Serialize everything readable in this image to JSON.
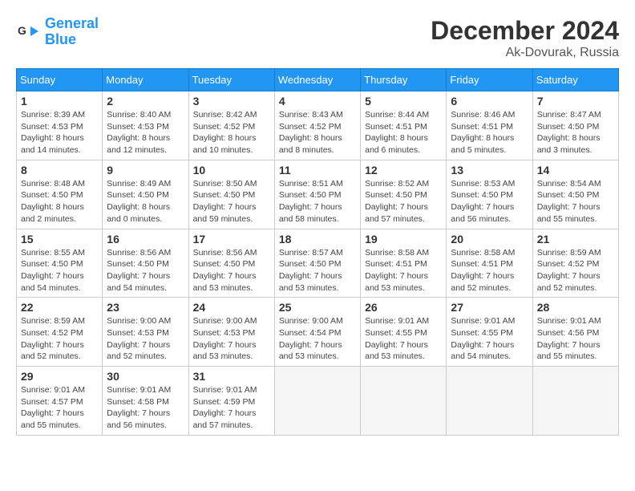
{
  "header": {
    "logo_line1": "General",
    "logo_line2": "Blue",
    "month_year": "December 2024",
    "location": "Ak-Dovurak, Russia"
  },
  "weekdays": [
    "Sunday",
    "Monday",
    "Tuesday",
    "Wednesday",
    "Thursday",
    "Friday",
    "Saturday"
  ],
  "weeks": [
    [
      {
        "day": "1",
        "info": "Sunrise: 8:39 AM\nSunset: 4:53 PM\nDaylight: 8 hours\nand 14 minutes."
      },
      {
        "day": "2",
        "info": "Sunrise: 8:40 AM\nSunset: 4:53 PM\nDaylight: 8 hours\nand 12 minutes."
      },
      {
        "day": "3",
        "info": "Sunrise: 8:42 AM\nSunset: 4:52 PM\nDaylight: 8 hours\nand 10 minutes."
      },
      {
        "day": "4",
        "info": "Sunrise: 8:43 AM\nSunset: 4:52 PM\nDaylight: 8 hours\nand 8 minutes."
      },
      {
        "day": "5",
        "info": "Sunrise: 8:44 AM\nSunset: 4:51 PM\nDaylight: 8 hours\nand 6 minutes."
      },
      {
        "day": "6",
        "info": "Sunrise: 8:46 AM\nSunset: 4:51 PM\nDaylight: 8 hours\nand 5 minutes."
      },
      {
        "day": "7",
        "info": "Sunrise: 8:47 AM\nSunset: 4:50 PM\nDaylight: 8 hours\nand 3 minutes."
      }
    ],
    [
      {
        "day": "8",
        "info": "Sunrise: 8:48 AM\nSunset: 4:50 PM\nDaylight: 8 hours\nand 2 minutes."
      },
      {
        "day": "9",
        "info": "Sunrise: 8:49 AM\nSunset: 4:50 PM\nDaylight: 8 hours\nand 0 minutes."
      },
      {
        "day": "10",
        "info": "Sunrise: 8:50 AM\nSunset: 4:50 PM\nDaylight: 7 hours\nand 59 minutes."
      },
      {
        "day": "11",
        "info": "Sunrise: 8:51 AM\nSunset: 4:50 PM\nDaylight: 7 hours\nand 58 minutes."
      },
      {
        "day": "12",
        "info": "Sunrise: 8:52 AM\nSunset: 4:50 PM\nDaylight: 7 hours\nand 57 minutes."
      },
      {
        "day": "13",
        "info": "Sunrise: 8:53 AM\nSunset: 4:50 PM\nDaylight: 7 hours\nand 56 minutes."
      },
      {
        "day": "14",
        "info": "Sunrise: 8:54 AM\nSunset: 4:50 PM\nDaylight: 7 hours\nand 55 minutes."
      }
    ],
    [
      {
        "day": "15",
        "info": "Sunrise: 8:55 AM\nSunset: 4:50 PM\nDaylight: 7 hours\nand 54 minutes."
      },
      {
        "day": "16",
        "info": "Sunrise: 8:56 AM\nSunset: 4:50 PM\nDaylight: 7 hours\nand 54 minutes."
      },
      {
        "day": "17",
        "info": "Sunrise: 8:56 AM\nSunset: 4:50 PM\nDaylight: 7 hours\nand 53 minutes."
      },
      {
        "day": "18",
        "info": "Sunrise: 8:57 AM\nSunset: 4:50 PM\nDaylight: 7 hours\nand 53 minutes."
      },
      {
        "day": "19",
        "info": "Sunrise: 8:58 AM\nSunset: 4:51 PM\nDaylight: 7 hours\nand 53 minutes."
      },
      {
        "day": "20",
        "info": "Sunrise: 8:58 AM\nSunset: 4:51 PM\nDaylight: 7 hours\nand 52 minutes."
      },
      {
        "day": "21",
        "info": "Sunrise: 8:59 AM\nSunset: 4:52 PM\nDaylight: 7 hours\nand 52 minutes."
      }
    ],
    [
      {
        "day": "22",
        "info": "Sunrise: 8:59 AM\nSunset: 4:52 PM\nDaylight: 7 hours\nand 52 minutes."
      },
      {
        "day": "23",
        "info": "Sunrise: 9:00 AM\nSunset: 4:53 PM\nDaylight: 7 hours\nand 52 minutes."
      },
      {
        "day": "24",
        "info": "Sunrise: 9:00 AM\nSunset: 4:53 PM\nDaylight: 7 hours\nand 53 minutes."
      },
      {
        "day": "25",
        "info": "Sunrise: 9:00 AM\nSunset: 4:54 PM\nDaylight: 7 hours\nand 53 minutes."
      },
      {
        "day": "26",
        "info": "Sunrise: 9:01 AM\nSunset: 4:55 PM\nDaylight: 7 hours\nand 53 minutes."
      },
      {
        "day": "27",
        "info": "Sunrise: 9:01 AM\nSunset: 4:55 PM\nDaylight: 7 hours\nand 54 minutes."
      },
      {
        "day": "28",
        "info": "Sunrise: 9:01 AM\nSunset: 4:56 PM\nDaylight: 7 hours\nand 55 minutes."
      }
    ],
    [
      {
        "day": "29",
        "info": "Sunrise: 9:01 AM\nSunset: 4:57 PM\nDaylight: 7 hours\nand 55 minutes."
      },
      {
        "day": "30",
        "info": "Sunrise: 9:01 AM\nSunset: 4:58 PM\nDaylight: 7 hours\nand 56 minutes."
      },
      {
        "day": "31",
        "info": "Sunrise: 9:01 AM\nSunset: 4:59 PM\nDaylight: 7 hours\nand 57 minutes."
      },
      {
        "day": "",
        "info": ""
      },
      {
        "day": "",
        "info": ""
      },
      {
        "day": "",
        "info": ""
      },
      {
        "day": "",
        "info": ""
      }
    ]
  ]
}
